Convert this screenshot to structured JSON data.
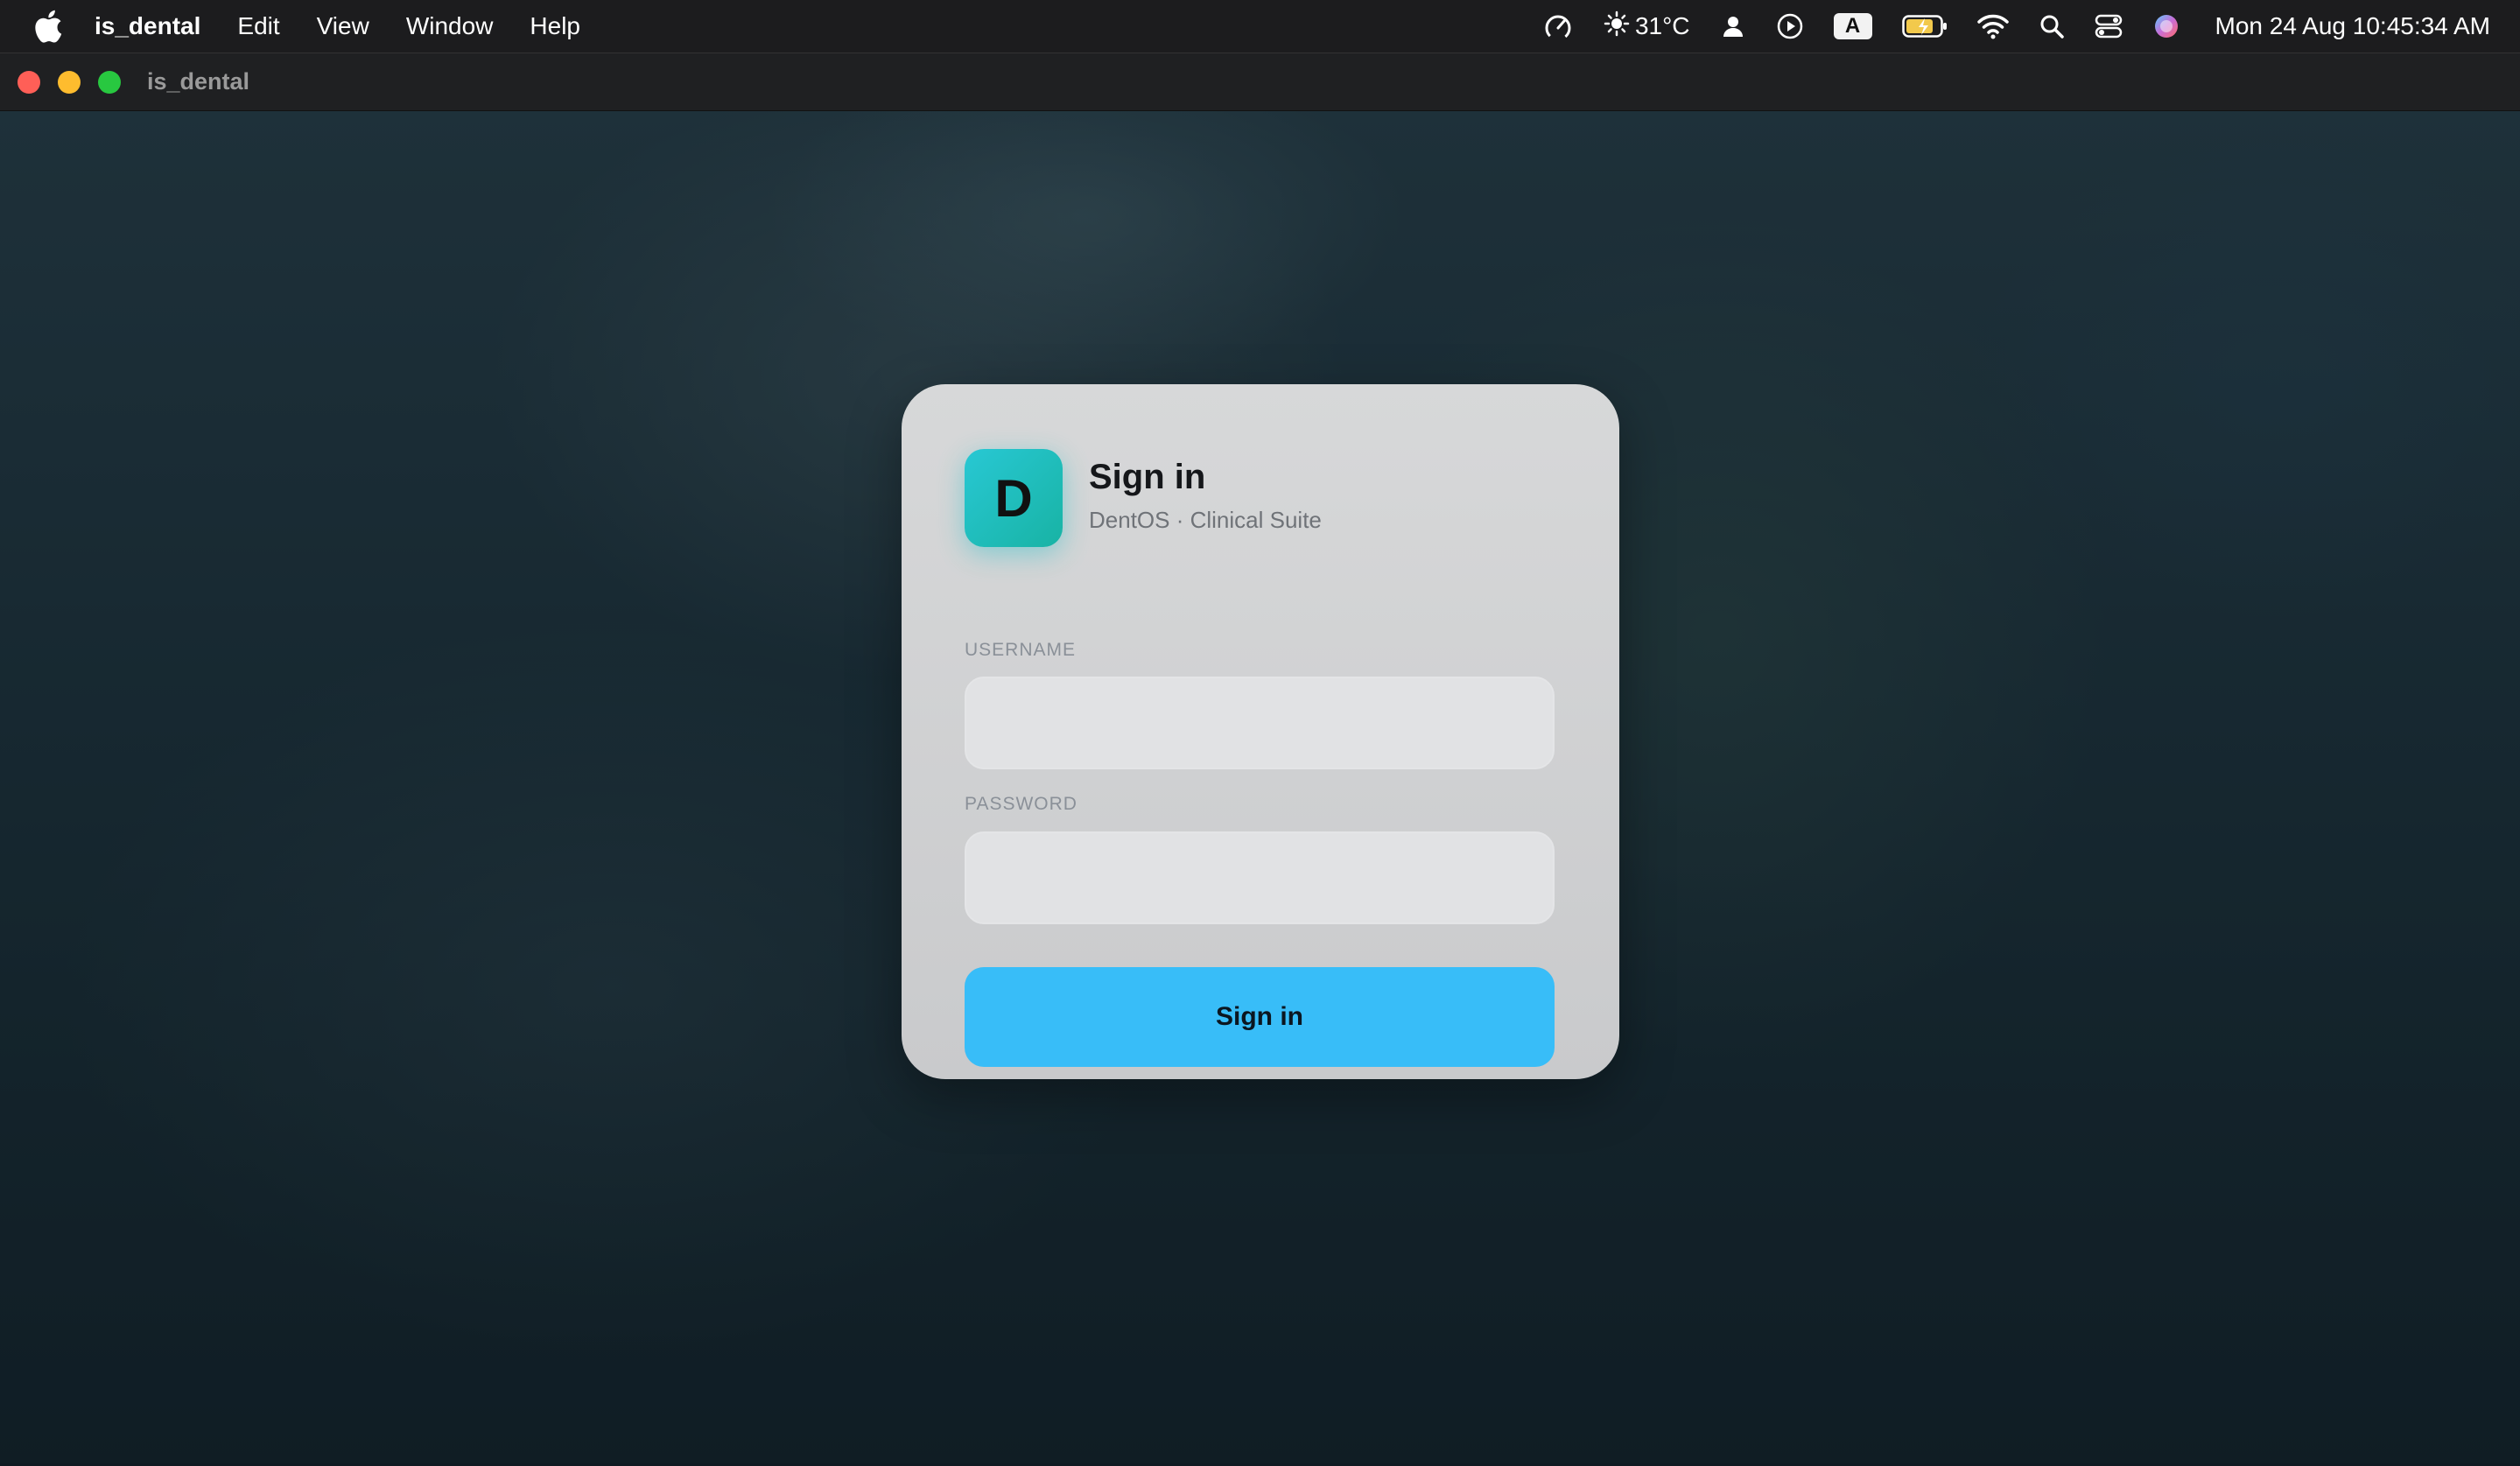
{
  "menubar": {
    "app_name": "is_dental",
    "items": [
      "Edit",
      "View",
      "Window",
      "Help"
    ],
    "weather": "31°C",
    "keyboard_input": "A",
    "date": "Mon 24 Aug",
    "time": "10:45:34 AM"
  },
  "window": {
    "title": "is_dental"
  },
  "signin": {
    "brand_letter": "D",
    "title": "Sign in",
    "subtitle": "DentOS · Clinical Suite",
    "username_label": "USERNAME",
    "username_value": "",
    "password_label": "PASSWORD",
    "password_value": "",
    "button_label": "Sign in"
  },
  "colors": {
    "accent": "#38bdf8",
    "brand_tile": "#22c1c3",
    "card": "#d2d3d5"
  },
  "icons": [
    "apple-icon",
    "speedometer-icon",
    "sun-icon",
    "user-icon",
    "play-icon",
    "battery-icon",
    "wifi-icon",
    "search-icon",
    "control-center-icon",
    "siri-icon"
  ]
}
